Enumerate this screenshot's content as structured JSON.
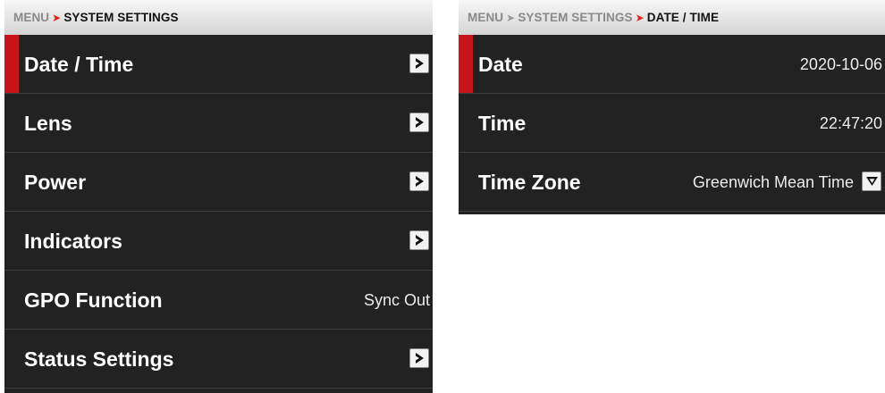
{
  "left": {
    "breadcrumb": {
      "root": "MENU",
      "sep": "➤",
      "current": "SYSTEM SETTINGS"
    },
    "items": [
      {
        "label": "Date / Time"
      },
      {
        "label": "Lens"
      },
      {
        "label": "Power"
      },
      {
        "label": "Indicators"
      },
      {
        "label": "GPO Function",
        "value": "Sync Out"
      },
      {
        "label": "Status Settings"
      }
    ],
    "selected_index": 0
  },
  "right": {
    "breadcrumb": {
      "root": "MENU",
      "sep": "➤",
      "middle": "SYSTEM SETTINGS",
      "current": "DATE / TIME"
    },
    "rows": [
      {
        "label": "Date",
        "value": "2020-10-06"
      },
      {
        "label": "Time",
        "value": "22:47:20"
      },
      {
        "label": "Time Zone",
        "value": "Greenwich Mean Time"
      }
    ],
    "selected_index": 0
  },
  "colors": {
    "accent": "#c8141b",
    "panel_bg": "#222222",
    "crumb_arrow": "#e1251b"
  },
  "icons": {
    "submenu": "chevron-right-icon",
    "dropdown": "chevron-down-icon"
  }
}
